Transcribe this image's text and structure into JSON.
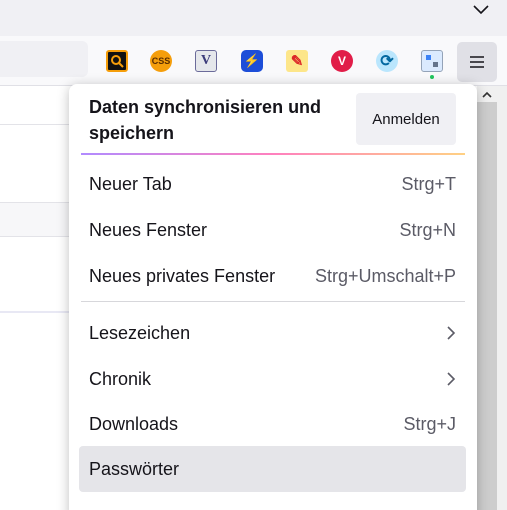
{
  "toolbar": {
    "extensions": [
      {
        "name": "search-extension-icon",
        "glyph": "",
        "color": "#f59e0b"
      },
      {
        "name": "css-extension-icon",
        "glyph": "CSS",
        "color": "#d97706"
      },
      {
        "name": "v-extension-icon",
        "glyph": "V",
        "color": "#4b4b8f"
      },
      {
        "name": "lightning-extension-icon",
        "glyph": "⚡",
        "color": "#1d4ed8"
      },
      {
        "name": "edit-extension-icon",
        "glyph": "✎",
        "color": "#dc2626"
      },
      {
        "name": "vivaldi-extension-icon",
        "glyph": "V",
        "color": "#e11d48"
      },
      {
        "name": "sync-extension-icon",
        "glyph": "⟳",
        "color": "#0ea5e9"
      },
      {
        "name": "puzzle-extension-icon",
        "glyph": "",
        "color": "#64748b"
      }
    ]
  },
  "menu": {
    "sync_text": "Daten synchronisieren und speichern",
    "signin_label": "Anmelden",
    "items": [
      {
        "label": "Neuer Tab",
        "shortcut": "Strg+T"
      },
      {
        "label": "Neues Fenster",
        "shortcut": "Strg+N"
      },
      {
        "label": "Neues privates Fenster",
        "shortcut": "Strg+Umschalt+P"
      },
      {
        "label": "Lesezeichen",
        "shortcut": ""
      },
      {
        "label": "Chronik",
        "shortcut": ""
      },
      {
        "label": "Downloads",
        "shortcut": "Strg+J"
      },
      {
        "label": "Passwörter",
        "shortcut": ""
      }
    ]
  }
}
